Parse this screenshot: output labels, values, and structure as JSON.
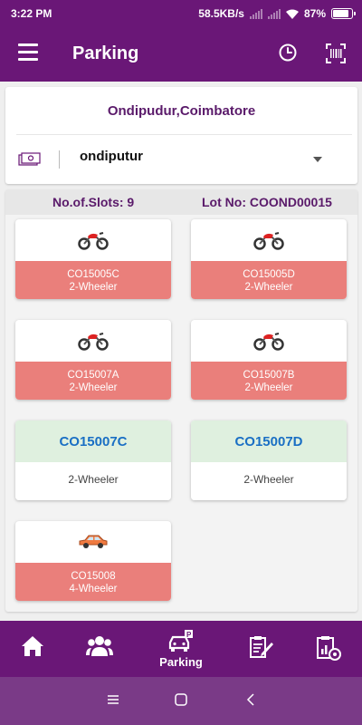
{
  "status_bar": {
    "time": "3:22 PM",
    "net_speed": "58.5KB/s",
    "battery": "87%",
    "battery_level": 0.87
  },
  "app_bar": {
    "title": "Parking",
    "icons": [
      "menu-icon",
      "clock-icon",
      "barcode-scan-icon"
    ]
  },
  "location": {
    "title": "Ondipudur,Coimbatore",
    "selected": "ondiputur",
    "icon": "money-icon"
  },
  "slots_header": {
    "count_label": "No.of.Slots: 9",
    "lot_label": "Lot No: COOND00015"
  },
  "slots": [
    {
      "code": "CO15005C",
      "type": "2-Wheeler",
      "status": "occupied",
      "vehicle": "motorcycle-icon"
    },
    {
      "code": "CO15005D",
      "type": "2-Wheeler",
      "status": "occupied",
      "vehicle": "motorcycle-icon"
    },
    {
      "code": "CO15007A",
      "type": "2-Wheeler",
      "status": "occupied",
      "vehicle": "motorcycle-icon"
    },
    {
      "code": "CO15007B",
      "type": "2-Wheeler",
      "status": "occupied",
      "vehicle": "motorcycle-icon"
    },
    {
      "code": "CO15007C",
      "type": "2-Wheeler",
      "status": "free"
    },
    {
      "code": "CO15007D",
      "type": "2-Wheeler",
      "status": "free"
    },
    {
      "code": "CO15008",
      "type": "4-Wheeler",
      "status": "occupied",
      "vehicle": "car-icon"
    }
  ],
  "bottom_nav": [
    {
      "icon": "home-icon",
      "label": ""
    },
    {
      "icon": "users-icon",
      "label": ""
    },
    {
      "icon": "parking-car-icon",
      "label": "Parking"
    },
    {
      "icon": "form-edit-icon",
      "label": ""
    },
    {
      "icon": "report-settings-icon",
      "label": ""
    }
  ],
  "colors": {
    "primary": "#6a1777",
    "occupied": "#ea7f7b",
    "free": "#dff0df",
    "free_text": "#1a6fc4"
  }
}
